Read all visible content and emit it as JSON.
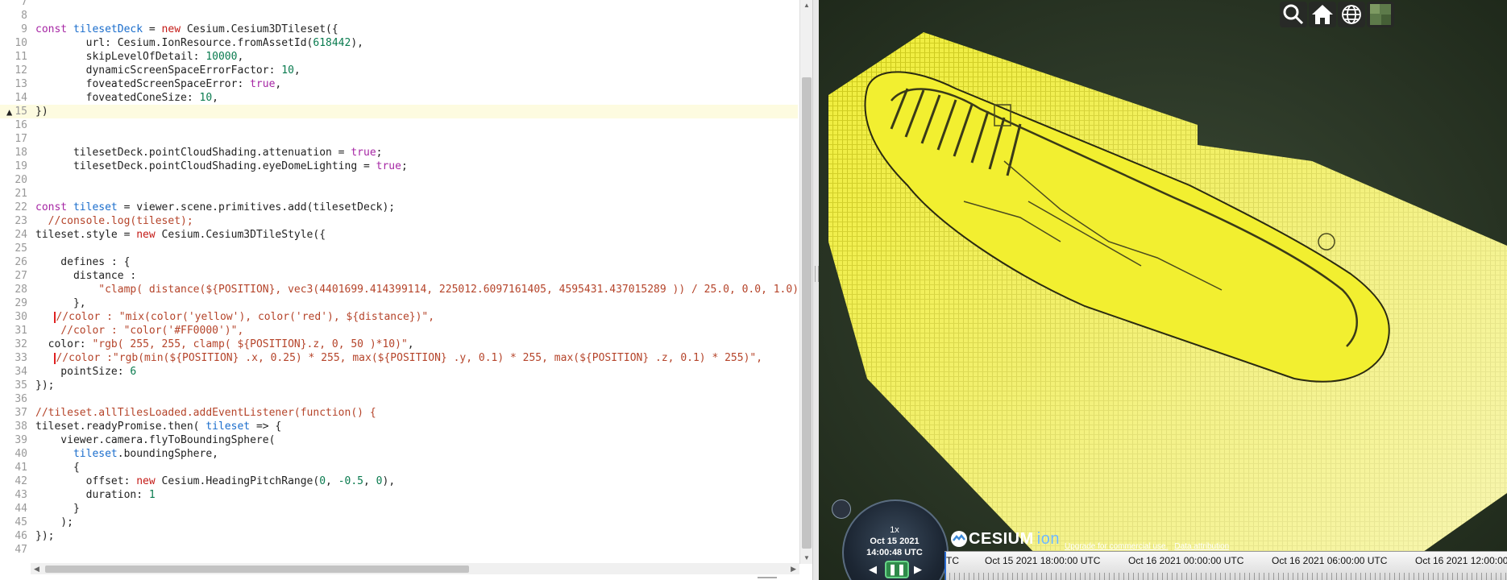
{
  "editor": {
    "warning_line": "15",
    "lines": [
      {
        "n": "7",
        "html": ""
      },
      {
        "n": "8",
        "html": ""
      },
      {
        "n": "9",
        "html": "<span class=\"kw2\">const</span> <span class=\"var\">tilesetDeck</span> = <span class=\"kw\">new</span> Cesium.Cesium3DTileset({"
      },
      {
        "n": "10",
        "html": "        url: Cesium.IonResource.fromAssetId(<span class=\"num\">618442</span>),"
      },
      {
        "n": "11",
        "html": "        skipLevelOfDetail: <span class=\"num\">10000</span>,"
      },
      {
        "n": "12",
        "html": "        dynamicScreenSpaceErrorFactor: <span class=\"num\">10</span>,"
      },
      {
        "n": "13",
        "html": "        foveatedScreenSpaceError: <span class=\"kw2\">true</span>,"
      },
      {
        "n": "14",
        "html": "        foveatedConeSize: <span class=\"num\">10</span>,"
      },
      {
        "n": "15",
        "html": "})"
      },
      {
        "n": "16",
        "html": ""
      },
      {
        "n": "17",
        "html": ""
      },
      {
        "n": "18",
        "html": "      tilesetDeck.pointCloudShading.attenuation = <span class=\"kw2\">true</span>;"
      },
      {
        "n": "19",
        "html": "      tilesetDeck.pointCloudShading.eyeDomeLighting = <span class=\"kw2\">true</span>;"
      },
      {
        "n": "20",
        "html": ""
      },
      {
        "n": "21",
        "html": ""
      },
      {
        "n": "22",
        "html": "<span class=\"kw2\">const</span> <span class=\"var\">tileset</span> = viewer.scene.primitives.add(tilesetDeck);"
      },
      {
        "n": "23",
        "html": "  <span class=\"cm\">//console.log(tileset);</span>"
      },
      {
        "n": "24",
        "html": "tileset.style = <span class=\"kw\">new</span> Cesium.Cesium3DTileStyle({"
      },
      {
        "n": "25",
        "html": ""
      },
      {
        "n": "26",
        "html": "    defines : {"
      },
      {
        "n": "27",
        "html": "      distance :"
      },
      {
        "n": "28",
        "html": "          <span class=\"str\">\"clamp( distance(${POSITION}, vec3(4401699.414399114, 225012.6097161405, 4595431.437015289 )) / 25.0, 0.0, 1.0)\"</span>"
      },
      {
        "n": "29",
        "html": "      },"
      },
      {
        "n": "30",
        "html": "   <span class=\"lint-mark\"></span><span class=\"cm\">//color : \"mix(color('yellow'), color('red'), ${distance})\",</span>"
      },
      {
        "n": "31",
        "html": "    <span class=\"cm\">//color : \"color('#FF0000')\",</span>"
      },
      {
        "n": "32",
        "html": "  color: <span class=\"str\">\"rgb( 255, 255, clamp( ${POSITION}.z, 0, 50 )*10)\"</span>,"
      },
      {
        "n": "33",
        "html": "   <span class=\"lint-mark\"></span><span class=\"cm\">//color :\"rgb(min(${POSITION} .x, 0.25) * 255, max(${POSITION} .y, 0.1) * 255, max(${POSITION} .z, 0.1) * 255)\",</span>"
      },
      {
        "n": "34",
        "html": "    pointSize: <span class=\"num\">6</span>"
      },
      {
        "n": "35",
        "html": "});"
      },
      {
        "n": "36",
        "html": ""
      },
      {
        "n": "37",
        "html": "<span class=\"cm\">//tileset.allTilesLoaded.addEventListener(function() {</span>"
      },
      {
        "n": "38",
        "html": "tileset.readyPromise.then( <span class=\"var\">tileset</span> =&gt; {"
      },
      {
        "n": "39",
        "html": "    viewer.camera.flyToBoundingSphere("
      },
      {
        "n": "40",
        "html": "      <span class=\"var\">tileset</span>.boundingSphere,"
      },
      {
        "n": "41",
        "html": "      {"
      },
      {
        "n": "42",
        "html": "        offset: <span class=\"kw\">new</span> Cesium.HeadingPitchRange(<span class=\"num\">0</span>, <span class=\"num\">-0.5</span>, <span class=\"num\">0</span>),"
      },
      {
        "n": "43",
        "html": "        duration: <span class=\"num\">1</span>"
      },
      {
        "n": "44",
        "html": "      }"
      },
      {
        "n": "45",
        "html": "    );"
      },
      {
        "n": "46",
        "html": "});"
      },
      {
        "n": "47",
        "html": ""
      }
    ]
  },
  "viewer": {
    "toolbar": [
      "search-icon",
      "home-icon",
      "globe-icon",
      "imagery-layer-icon"
    ],
    "animation": {
      "speed": "1x",
      "date": "Oct 15 2021",
      "time": "14:00:48 UTC",
      "reverse": "◀",
      "pause": "❚❚",
      "play": "▶"
    },
    "credits": {
      "logo": "CESIUM",
      "logo_suffix": "ion",
      "upgrade": "Upgrade for commercial use.",
      "attribution": "Data attribution"
    },
    "timeline": {
      "labels": [
        "TC",
        "Oct 15 2021 18:00:00 UTC",
        "Oct 16 2021 00:00:00 UTC",
        "Oct 16 2021 06:00:00 UTC",
        "Oct 16 2021 12:00:00"
      ]
    },
    "colors": {
      "point_cloud": "#e8e61e",
      "ground": "#2c3a28",
      "timeline_needle": "#2a6bd1"
    }
  }
}
